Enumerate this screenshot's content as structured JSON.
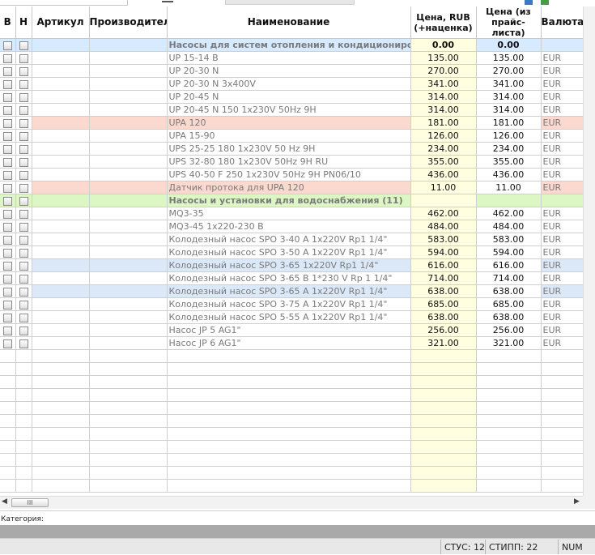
{
  "headers": {
    "v": "В",
    "n": "Н",
    "article": "Артикул",
    "manufacturer": "Производитель",
    "name": "Наименование",
    "price": "Цена, RUB (+наценка)",
    "price_list": "Цена (из прайс-листа)",
    "currency": "Валюта"
  },
  "rows": [
    {
      "kind": "group-blue",
      "name": "Насосы для систем отопления и кондиционирования",
      "price": "0.00",
      "price_list": "0.00",
      "currency": ""
    },
    {
      "kind": "item",
      "name": "UP 15-14 B",
      "price": "135.00",
      "price_list": "135.00",
      "currency": "EUR"
    },
    {
      "kind": "item",
      "name": "UP 20-30 N",
      "price": "270.00",
      "price_list": "270.00",
      "currency": "EUR"
    },
    {
      "kind": "item",
      "name": "UP 20-30 N 3x400V",
      "price": "341.00",
      "price_list": "341.00",
      "currency": "EUR"
    },
    {
      "kind": "item",
      "name": "UP 20-45 N",
      "price": "314.00",
      "price_list": "314.00",
      "currency": "EUR"
    },
    {
      "kind": "item",
      "name": "UP 20-45 N 150 1x230V 50Hz 9H",
      "price": "314.00",
      "price_list": "314.00",
      "currency": "EUR"
    },
    {
      "kind": "pink",
      "name": "UPA 120",
      "price": "181.00",
      "price_list": "181.00",
      "currency": "EUR"
    },
    {
      "kind": "item",
      "name": "UPA 15-90",
      "price": "126.00",
      "price_list": "126.00",
      "currency": "EUR"
    },
    {
      "kind": "item",
      "name": "UPS 25-25 180  1x230V 50 Hz 9H",
      "price": "234.00",
      "price_list": "234.00",
      "currency": "EUR"
    },
    {
      "kind": "item",
      "name": "UPS 32-80 180  1x230V 50Hz 9H RU",
      "price": "355.00",
      "price_list": "355.00",
      "currency": "EUR"
    },
    {
      "kind": "item",
      "name": "UPS 40-50 F 250 1x230V 50Hz 9H PN06/10",
      "price": "436.00",
      "price_list": "436.00",
      "currency": "EUR"
    },
    {
      "kind": "pink",
      "name": "Датчик протока для UPA 120",
      "price": "11.00",
      "price_list": "11.00",
      "currency": "EUR"
    },
    {
      "kind": "group-green",
      "name": "Насосы и установки для водоснабжения (11)",
      "price": "",
      "price_list": "",
      "currency": ""
    },
    {
      "kind": "item",
      "name": "MQ3-35",
      "price": "462.00",
      "price_list": "462.00",
      "currency": "EUR"
    },
    {
      "kind": "item",
      "name": "MQ3-45 1x220-230 B",
      "price": "484.00",
      "price_list": "484.00",
      "currency": "EUR"
    },
    {
      "kind": "item",
      "name": "Колодезный насос SPO 3-40 A 1x220V Rp1 1/4\"",
      "price": "583.00",
      "price_list": "583.00",
      "currency": "EUR"
    },
    {
      "kind": "item",
      "name": "Колодезный насос SPO 3-50 A 1x220V Rp1 1/4\"",
      "price": "594.00",
      "price_list": "594.00",
      "currency": "EUR"
    },
    {
      "kind": "selected",
      "name": "Колодезный насос SPO 3-65 1x220V Rp1 1/4\"",
      "price": "616.00",
      "price_list": "616.00",
      "currency": "EUR"
    },
    {
      "kind": "item",
      "name": "Колодезный насос SPO 3-65 B  1*230 V Rp 1 1/4\"",
      "price": "714.00",
      "price_list": "714.00",
      "currency": "EUR"
    },
    {
      "kind": "selected",
      "name": "Колодезный насос SPO 3-65 A 1x220V Rp1 1/4\"",
      "price": "638.00",
      "price_list": "638.00",
      "currency": "EUR"
    },
    {
      "kind": "item",
      "name": "Колодезный насос SPO 3-75 A 1x220V Rp1 1/4\"",
      "price": "685.00",
      "price_list": "685.00",
      "currency": "EUR"
    },
    {
      "kind": "item",
      "name": "Колодезный насос SPO 5-55 A 1x220V Rp1 1/4\"",
      "price": "638.00",
      "price_list": "638.00",
      "currency": "EUR"
    },
    {
      "kind": "item",
      "name": "Насос JP 5 AG1\"",
      "price": "256.00",
      "price_list": "256.00",
      "currency": "EUR"
    },
    {
      "kind": "item",
      "name": "Насос JP 6 AG1\"",
      "price": "321.00",
      "price_list": "321.00",
      "currency": "EUR"
    }
  ],
  "empty_rows": 11,
  "scroll_thumb_glyph": "III",
  "category_label": "Категория:",
  "status": {
    "stus": "СТУС: 12",
    "stipp": "СТИПП: 22",
    "num": "NUM"
  },
  "colors": {
    "price_column": "#ffffe0",
    "group_blue": "#d6ebff",
    "group_green": "#dcf7c4",
    "row_pink": "#fbd9cf",
    "row_selected": "#dbe8f8"
  }
}
